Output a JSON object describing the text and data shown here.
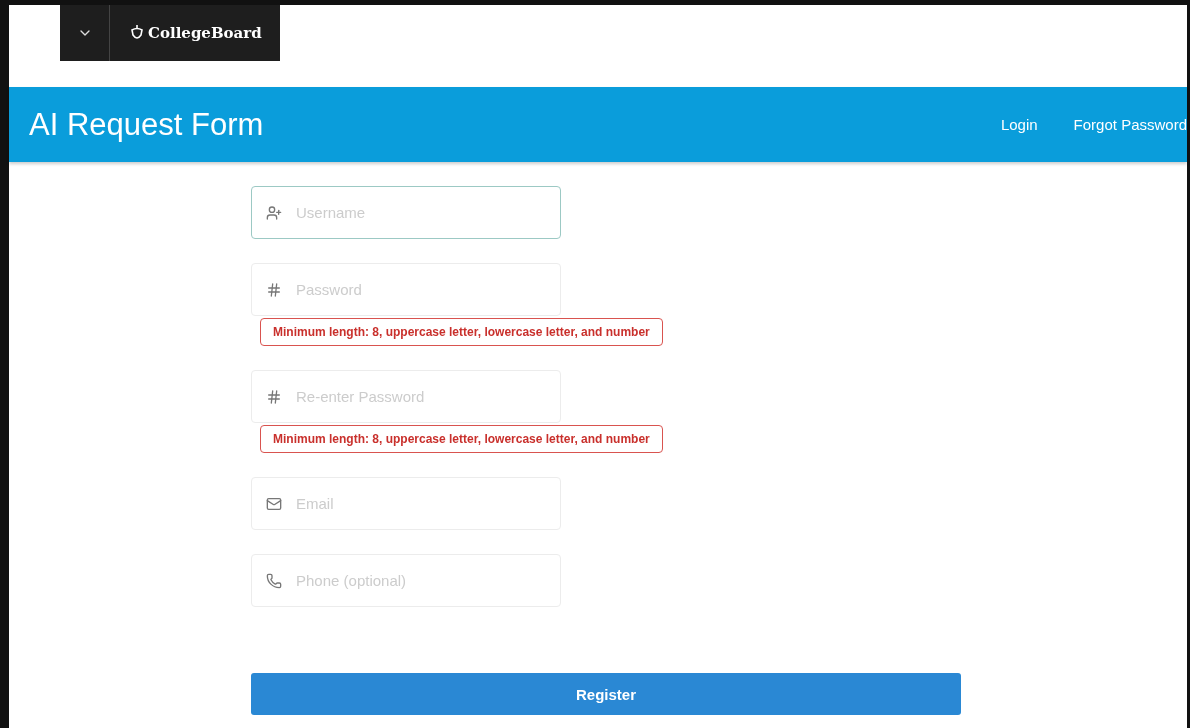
{
  "brand": {
    "name": "CollegeBoard"
  },
  "header": {
    "title": "AI Request Form",
    "links": [
      "Login",
      "Forgot Password"
    ]
  },
  "fields": [
    {
      "kind": "user",
      "placeholder": "Username",
      "focused": true
    },
    {
      "kind": "password",
      "placeholder": "Password",
      "focused": false,
      "error": "Minimum length: 8, uppercase letter, lowercase letter, and number"
    },
    {
      "kind": "password",
      "placeholder": "Re-enter Password",
      "focused": false,
      "error": "Minimum length: 8, uppercase letter, lowercase letter, and number"
    },
    {
      "kind": "email",
      "placeholder": "Email",
      "focused": false
    },
    {
      "kind": "phone",
      "placeholder": "Phone (optional)",
      "focused": false
    }
  ],
  "submit": {
    "label": "Register"
  }
}
